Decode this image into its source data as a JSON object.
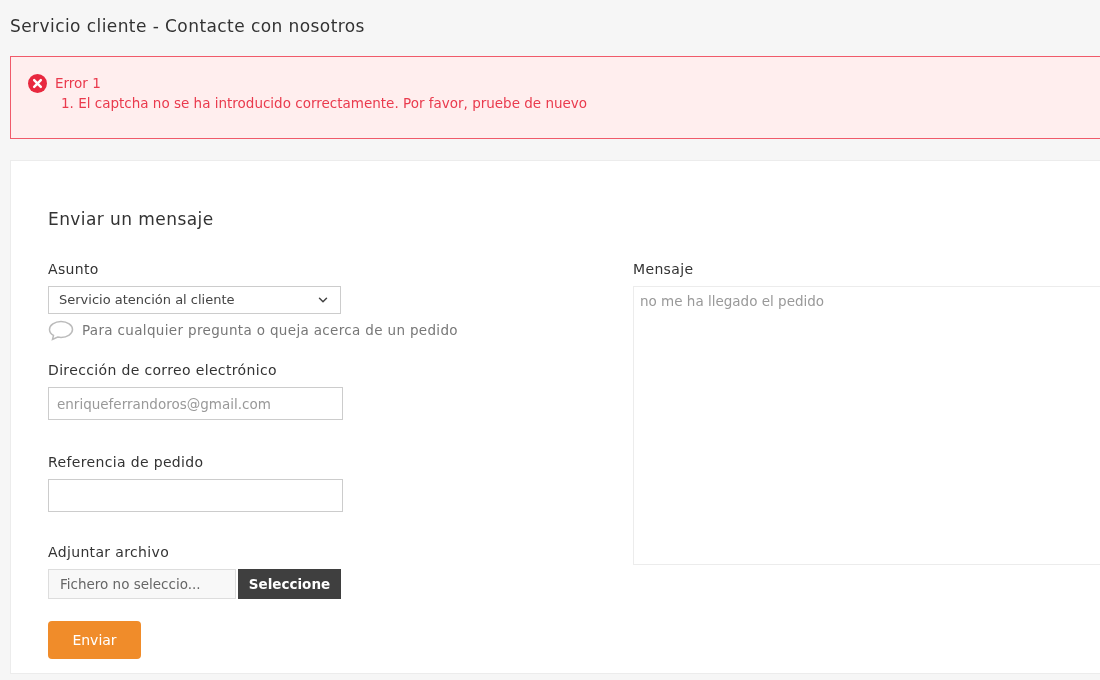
{
  "page_title": "Servicio cliente - Contacte con nosotros",
  "alert": {
    "title": "Error 1",
    "messages": [
      "1. El captcha no se ha introducido correctamente. Por favor, pruebe de nuevo"
    ]
  },
  "form": {
    "heading": "Enviar un mensaje",
    "subject": {
      "label": "Asunto",
      "value": "Servicio atención al cliente",
      "hint": "Para cualquier pregunta o queja acerca de un pedido"
    },
    "email": {
      "label": "Dirección de correo electrónico",
      "value": "enriqueferrandoros@gmail.com"
    },
    "order_reference": {
      "label": "Referencia de pedido"
    },
    "attachment": {
      "label": "Adjuntar archivo",
      "file_name": "Fichero no seleccio...",
      "button": "Seleccione"
    },
    "message": {
      "label": "Mensaje",
      "value": "no me ha llegado el pedido"
    },
    "submit": "Enviar"
  }
}
